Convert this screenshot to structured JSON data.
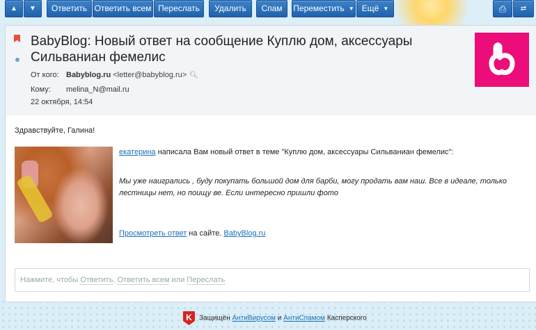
{
  "toolbar": {
    "up_icon": "arrow-up-icon",
    "down_icon": "arrow-down-icon",
    "reply_label": "Ответить",
    "reply_all_label": "Ответить всем",
    "forward_label": "Переслать",
    "delete_label": "Удалить",
    "spam_label": "Спам",
    "move_label": "Переместить",
    "more_label": "Ещё",
    "print_icon": "printer-icon",
    "translate_icon": "translate-icon"
  },
  "message": {
    "subject": "BabyBlog: Новый ответ на сообщение Куплю дом, аксессуары Сильваниан фемелис",
    "from_label": "От кого:",
    "from_name": "Babyblog.ru",
    "from_email": "<letter@babyblog.ru>",
    "to_label": "Кому:",
    "to_email": "melina_N@mail.ru",
    "date": "22 октября, 14:54",
    "logo_glyph": "b"
  },
  "body": {
    "greeting": "Здравствуйте, Галина!",
    "author": "екатерина",
    "intro": " написала Вам новый ответ в теме \"Куплю дом, аксессуары Сильваниан фемелис\":",
    "quote": "Мы уже наигрались , буду покупать большой дом для барби, могу продать вам наш. Все в идеале, только лестницы нет, но поищу ве. Если интересно пришли фото",
    "view_link": "Просмотреть ответ",
    "on_site": " на сайте. ",
    "site_link": "BabyBlog.ru"
  },
  "reply": {
    "prefix": "Нажмите, чтобы ",
    "reply": "Ответить",
    "sep1": ", ",
    "reply_all": "Ответить всем",
    "or": " или ",
    "forward": "Переслать"
  },
  "footer": {
    "kaspersky_glyph": "K",
    "prefix": "Защищён ",
    "antivirus": "АнтиВирусом",
    "and": " и ",
    "antispam": "АнтиСпамом",
    "suffix": " Касперского"
  }
}
